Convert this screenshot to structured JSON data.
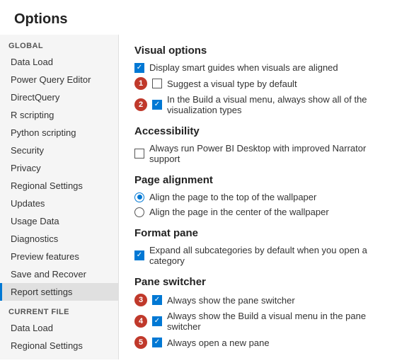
{
  "page": {
    "title": "Options"
  },
  "sidebar": {
    "global_label": "GLOBAL",
    "global_items": [
      {
        "label": "Data Load",
        "active": false
      },
      {
        "label": "Power Query Editor",
        "active": false
      },
      {
        "label": "DirectQuery",
        "active": false
      },
      {
        "label": "R scripting",
        "active": false
      },
      {
        "label": "Python scripting",
        "active": false
      },
      {
        "label": "Security",
        "active": false
      },
      {
        "label": "Privacy",
        "active": false
      },
      {
        "label": "Regional Settings",
        "active": false
      },
      {
        "label": "Updates",
        "active": false
      },
      {
        "label": "Usage Data",
        "active": false
      },
      {
        "label": "Diagnostics",
        "active": false
      },
      {
        "label": "Preview features",
        "active": false
      },
      {
        "label": "Save and Recover",
        "active": false
      },
      {
        "label": "Report settings",
        "active": true
      }
    ],
    "current_file_label": "CURRENT FILE",
    "current_file_items": [
      {
        "label": "Data Load",
        "active": false
      },
      {
        "label": "Regional Settings",
        "active": false
      }
    ]
  },
  "main": {
    "sections": [
      {
        "heading": "Visual options",
        "options": [
          {
            "type": "checkbox",
            "checked": true,
            "badge": null,
            "label": "Display smart guides when visuals are aligned"
          },
          {
            "type": "checkbox",
            "checked": false,
            "badge": "1",
            "label": "Suggest a visual type by default"
          },
          {
            "type": "checkbox",
            "checked": true,
            "badge": "2",
            "label": "In the Build a visual menu, always show all of the visualization types"
          }
        ]
      },
      {
        "heading": "Accessibility",
        "options": [
          {
            "type": "checkbox",
            "checked": false,
            "badge": null,
            "label": "Always run Power BI Desktop with improved Narrator support"
          }
        ]
      },
      {
        "heading": "Page alignment",
        "options": [
          {
            "type": "radio",
            "checked": true,
            "badge": null,
            "label": "Align the page to the top of the wallpaper"
          },
          {
            "type": "radio",
            "checked": false,
            "badge": null,
            "label": "Align the page in the center of the wallpaper"
          }
        ]
      },
      {
        "heading": "Format pane",
        "options": [
          {
            "type": "checkbox",
            "checked": true,
            "badge": null,
            "label": "Expand all subcategories by default when you open a category"
          }
        ]
      },
      {
        "heading": "Pane switcher",
        "options": [
          {
            "type": "checkbox",
            "checked": true,
            "badge": "3",
            "label": "Always show the pane switcher"
          },
          {
            "type": "checkbox",
            "checked": true,
            "badge": "4",
            "label": "Always show the Build a visual menu in the pane switcher"
          },
          {
            "type": "checkbox",
            "checked": true,
            "badge": "5",
            "label": "Always open a new pane"
          }
        ]
      }
    ]
  }
}
